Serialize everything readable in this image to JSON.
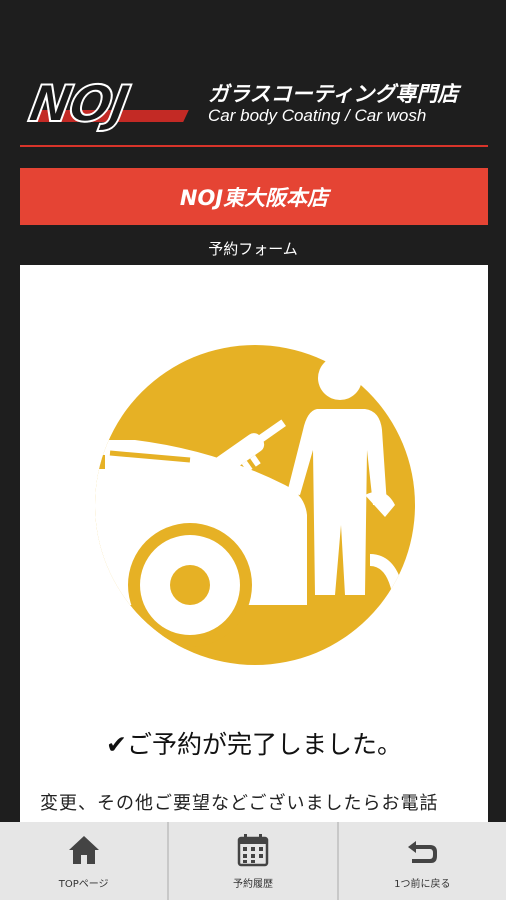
{
  "header": {
    "logo_text": "NOJ",
    "tagline_ja": "ガラスコーティング専門店",
    "tagline_en": "Car body Coating / Car wosh"
  },
  "store": {
    "name": "NOJ東大阪本店"
  },
  "form": {
    "label": "予約フォーム",
    "complete_message": "ご予約が完了しました。",
    "notice_text": "変更、その他ご要望などございましたらお電話"
  },
  "tabs": [
    {
      "label": "TOPページ",
      "icon": "home-icon"
    },
    {
      "label": "予約履歴",
      "icon": "calendar-icon"
    },
    {
      "label": "1つ前に戻る",
      "icon": "back-arrow-icon"
    }
  ],
  "colors": {
    "background": "#1e1e1e",
    "accent_red": "#e54434",
    "illustration_gold": "#e6b125",
    "tabbar": "#e6e6e6"
  }
}
